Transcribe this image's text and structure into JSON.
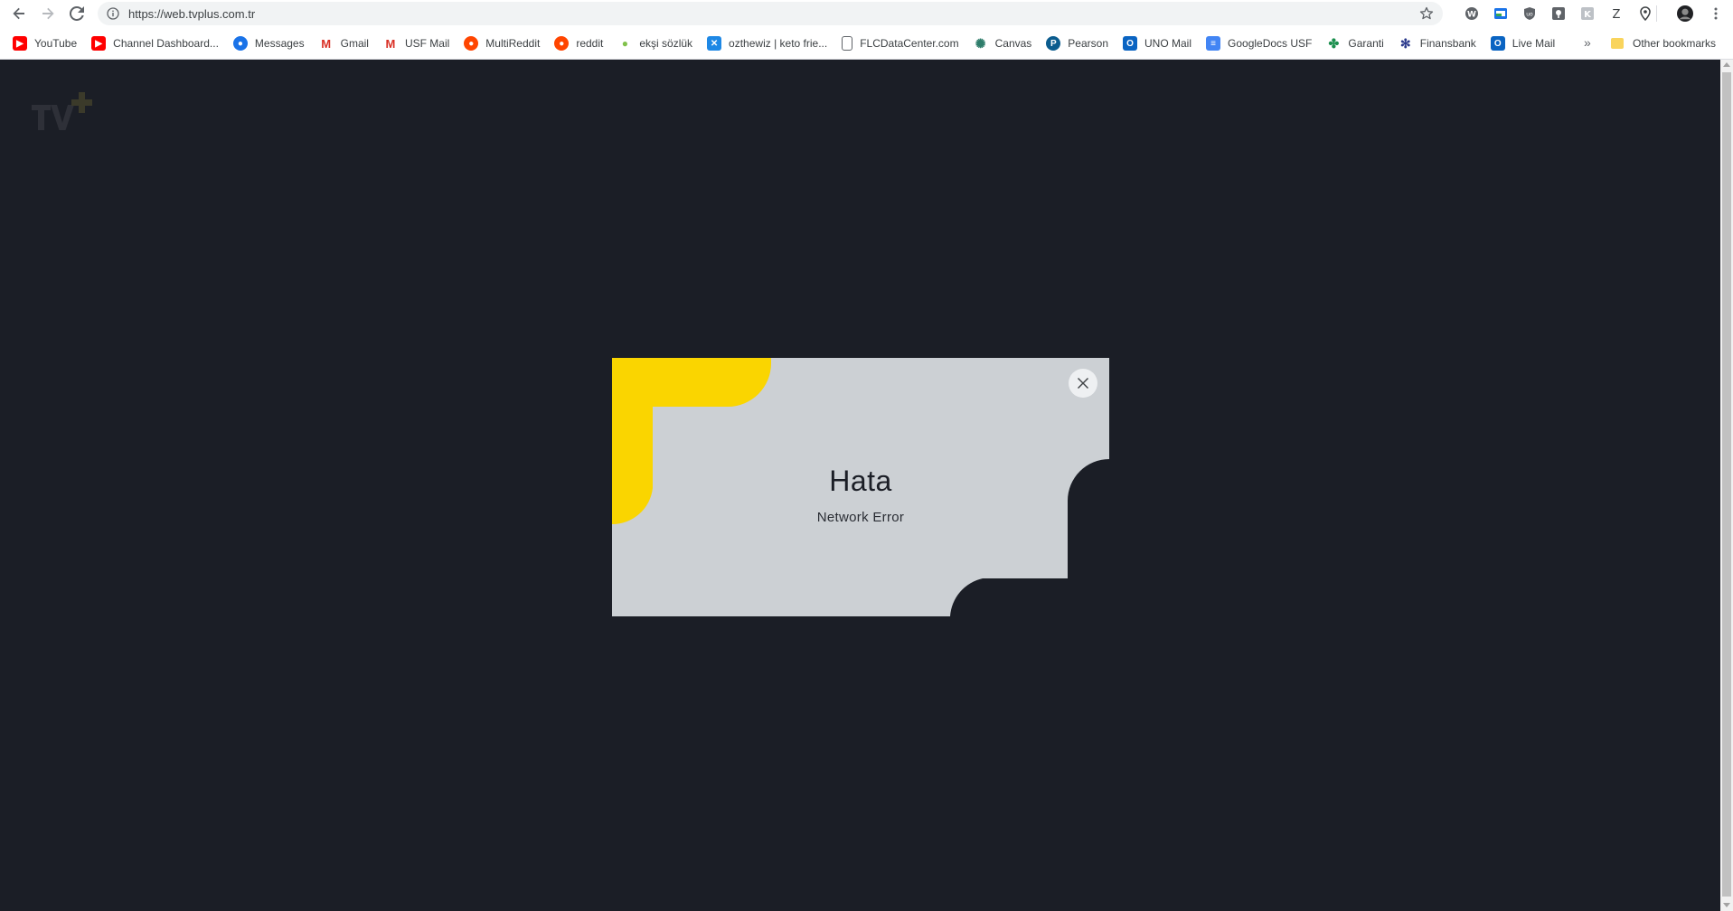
{
  "browser": {
    "url": "https://web.tvplus.com.tr",
    "bookmarks": [
      {
        "label": "YouTube",
        "icon": "youtube-icon",
        "color": "#ff0000"
      },
      {
        "label": "Channel Dashboard...",
        "icon": "youtube-icon",
        "color": "#ff0000"
      },
      {
        "label": "Messages",
        "icon": "messages-icon",
        "color": "#1a73e8"
      },
      {
        "label": "Gmail",
        "icon": "gmail-icon",
        "color": "#d93025"
      },
      {
        "label": "USF Mail",
        "icon": "gmail-icon",
        "color": "#d93025"
      },
      {
        "label": "MultiReddit",
        "icon": "reddit-icon",
        "color": "#ff4500"
      },
      {
        "label": "reddit",
        "icon": "reddit-icon",
        "color": "#ff4500"
      },
      {
        "label": "ekşi sözlük",
        "icon": "eksi-icon",
        "color": "#81c14b"
      },
      {
        "label": "ozthewiz | keto frie...",
        "icon": "ozthewiz-icon",
        "color": "#1e88e5"
      },
      {
        "label": "FLCDataCenter.com",
        "icon": "page-icon",
        "color": "#5f6368"
      },
      {
        "label": "Canvas",
        "icon": "canvas-icon",
        "color": "#2e7d6b"
      },
      {
        "label": "Pearson",
        "icon": "pearson-icon",
        "color": "#0b5c8e"
      },
      {
        "label": "UNO Mail",
        "icon": "outlook-icon",
        "color": "#0a64c2"
      },
      {
        "label": "GoogleDocs USF",
        "icon": "docs-icon",
        "color": "#4285f4"
      },
      {
        "label": "Garanti",
        "icon": "garanti-icon",
        "color": "#1b8f4e"
      },
      {
        "label": "Finansbank",
        "icon": "finansbank-icon",
        "color": "#2b3a8c"
      },
      {
        "label": "Live Mail",
        "icon": "outlook-icon",
        "color": "#0a64c2"
      }
    ],
    "more_label": "»",
    "other_bookmarks_label": "Other bookmarks"
  },
  "page": {
    "logo_text": "TV+",
    "modal": {
      "title": "Hata",
      "message": "Network Error",
      "colors": {
        "card": "#ccd0d4",
        "accent": "#fad500",
        "background": "#1b1e26"
      }
    }
  }
}
